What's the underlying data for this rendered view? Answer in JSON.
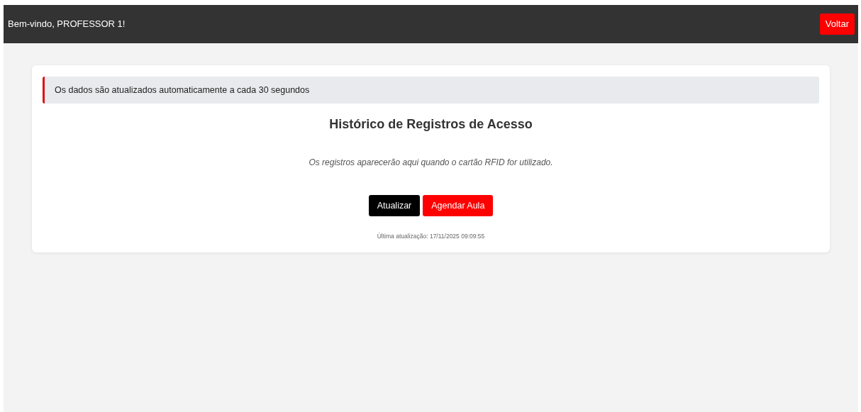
{
  "header": {
    "greeting": "Bem-vindo, PROFESSOR 1!",
    "back_button": "Voltar"
  },
  "notice": "Os dados são atualizados automaticamente a cada 30 segundos",
  "title": "Histórico de Registros de Acesso",
  "empty_message": "Os registros aparecerão aqui quando o cartão RFID for utilizado.",
  "buttons": [
    {
      "label": "Atualizar",
      "kind": "dark"
    },
    {
      "label": "Agendar Aula",
      "kind": "red"
    }
  ],
  "last_update": "Última atualização: 17/11/2025 09:09:55"
}
